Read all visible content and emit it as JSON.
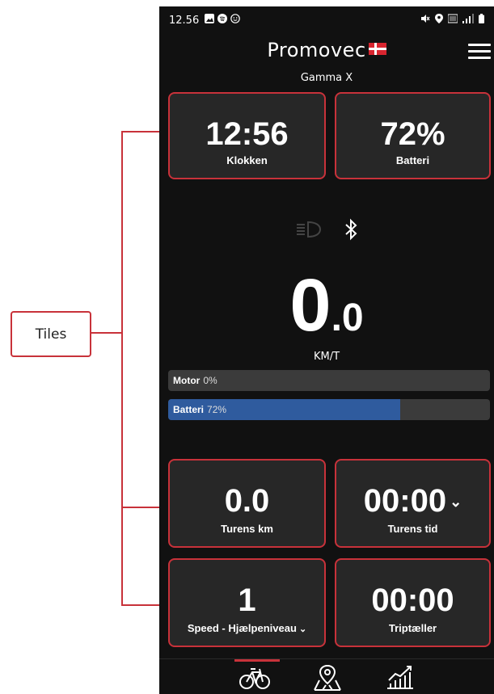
{
  "annotation": {
    "label": "Tiles"
  },
  "status_bar": {
    "time": "12.56",
    "left_icons": [
      "image-icon",
      "spotify-icon",
      "smiley-icon"
    ],
    "right_icons": [
      "mute-icon",
      "location-icon",
      "volte-icon",
      "signal-icon",
      "battery-icon"
    ]
  },
  "app": {
    "logo": "Promovec",
    "device_name": "Gamma X",
    "menu_icon": "hamburger-icon"
  },
  "tiles_top": [
    {
      "value": "12:56",
      "label": "Klokken"
    },
    {
      "value": "72%",
      "label": "Batteri"
    }
  ],
  "indicators": [
    "headlight-icon",
    "bluetooth-icon"
  ],
  "speed": {
    "integer": "0",
    "decimal": ".0",
    "unit": "KM/T"
  },
  "bars": {
    "motor": {
      "label": "Motor",
      "percent_text": "0%",
      "value": 0
    },
    "battery": {
      "label": "Batteri",
      "percent_text": "72%",
      "value": 0.72
    }
  },
  "tiles_bottom": [
    {
      "value": "0.0",
      "label": "Turens km"
    },
    {
      "value": "00:00",
      "label": "Turens tid"
    },
    {
      "value": "1",
      "label": "Speed - Hjælpeniveau"
    },
    {
      "value": "00:00",
      "label": "Triptæller"
    }
  ],
  "bottom_nav": [
    "bike-icon",
    "map-icon",
    "stats-icon"
  ],
  "colors": {
    "accent": "#c8323a",
    "battery_fill": "#2f5b9e",
    "background": "#111111",
    "tile": "#272727"
  }
}
